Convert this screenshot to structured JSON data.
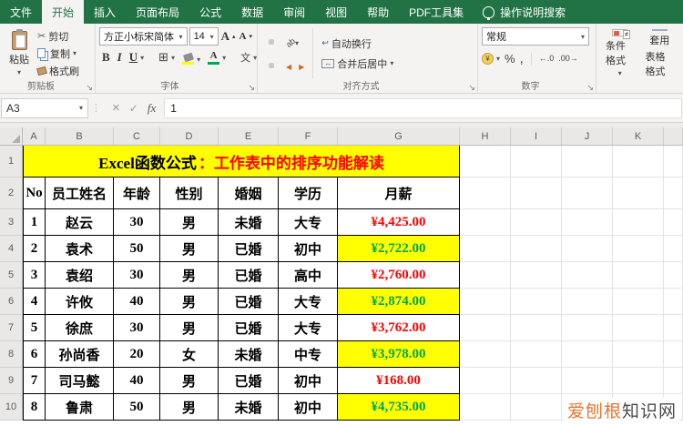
{
  "icons": {
    "dropdown": "▾",
    "launcher": "↘",
    "cancel": "×",
    "enter": "✓",
    "scissors": "✂",
    "borders": "⊞",
    "merge_arrows": "↔",
    "wrap_return": "↩",
    "orientation": "ab",
    "indent_left": "◀",
    "indent_right": "▶",
    "coin": "¥",
    "phonetic": "文",
    "letter_a": "A",
    "up": "▴",
    "down": "▾",
    "dots": "⋮"
  },
  "ribbon": {
    "tabs": [
      {
        "label": "文件"
      },
      {
        "label": "开始"
      },
      {
        "label": "插入"
      },
      {
        "label": "页面布局"
      },
      {
        "label": "公式"
      },
      {
        "label": "数据"
      },
      {
        "label": "审阅"
      },
      {
        "label": "视图"
      },
      {
        "label": "帮助"
      },
      {
        "label": "PDF工具集"
      }
    ],
    "tell_me": "操作说明搜索",
    "clipboard": {
      "group_label": "剪贴板",
      "paste": "粘贴",
      "cut": "剪切",
      "copy": "复制",
      "format_painter": "格式刷"
    },
    "font": {
      "group_label": "字体",
      "font_name": "方正小标宋简体",
      "font_size": "14",
      "bold": "B",
      "italic": "I",
      "underline": "U"
    },
    "alignment": {
      "group_label": "对齐方式",
      "wrap_text": "自动换行",
      "merge_center": "合并后居中"
    },
    "number": {
      "group_label": "数字",
      "format": "常规",
      "percent": "%",
      "comma": ",",
      "inc_decimal": "←.0",
      "dec_decimal": ".00→"
    },
    "styles": {
      "conditional_formatting": "条件格式",
      "format_as_table_line1": "套用",
      "format_as_table_line2": "表格格式"
    }
  },
  "formula_bar": {
    "name_box": "A3",
    "fx": "fx",
    "value": "1"
  },
  "sheet": {
    "columns": [
      "A",
      "B",
      "C",
      "D",
      "E",
      "F",
      "G",
      "H",
      "I",
      "J",
      "K"
    ],
    "row_numbers": [
      "1",
      "2",
      "3",
      "4",
      "5",
      "6",
      "7",
      "8",
      "9",
      "10"
    ],
    "title_black": "Excel函数公式",
    "title_red": "：工作表中的排序功能解读",
    "headers": [
      "No",
      "员工姓名",
      "年龄",
      "性别",
      "婚姻",
      "学历",
      "月薪"
    ],
    "rows": [
      {
        "no": "1",
        "name": "赵云",
        "age": "30",
        "gender": "男",
        "marital": "未婚",
        "education": "大专",
        "salary": "¥4,425.00"
      },
      {
        "no": "2",
        "name": "袁术",
        "age": "50",
        "gender": "男",
        "marital": "已婚",
        "education": "初中",
        "salary": "¥2,722.00"
      },
      {
        "no": "3",
        "name": "袁绍",
        "age": "30",
        "gender": "男",
        "marital": "已婚",
        "education": "高中",
        "salary": "¥2,760.00"
      },
      {
        "no": "4",
        "name": "许攸",
        "age": "40",
        "gender": "男",
        "marital": "已婚",
        "education": "大专",
        "salary": "¥2,874.00"
      },
      {
        "no": "5",
        "name": "徐庶",
        "age": "30",
        "gender": "男",
        "marital": "已婚",
        "education": "大专",
        "salary": "¥3,762.00"
      },
      {
        "no": "6",
        "name": "孙尚香",
        "age": "20",
        "gender": "女",
        "marital": "未婚",
        "education": "中专",
        "salary": "¥3,978.00"
      },
      {
        "no": "7",
        "name": "司马懿",
        "age": "40",
        "gender": "男",
        "marital": "已婚",
        "education": "初中",
        "salary": "¥168.00"
      },
      {
        "no": "8",
        "name": "鲁肃",
        "age": "50",
        "gender": "男",
        "marital": "未婚",
        "education": "初中",
        "salary": "¥4,735.00"
      }
    ]
  },
  "watermark": {
    "part1": "爱刨根",
    "part2": "知识网"
  },
  "colors": {
    "ribbon_green": "#217346",
    "highlight_yellow": "#ffff00",
    "salary_red": "#fe0000",
    "salary_green": "#00a651",
    "fill_swatch": "#ffff00",
    "font_color_swatch": "#00a651",
    "watermark_orange": "#e4762f"
  }
}
